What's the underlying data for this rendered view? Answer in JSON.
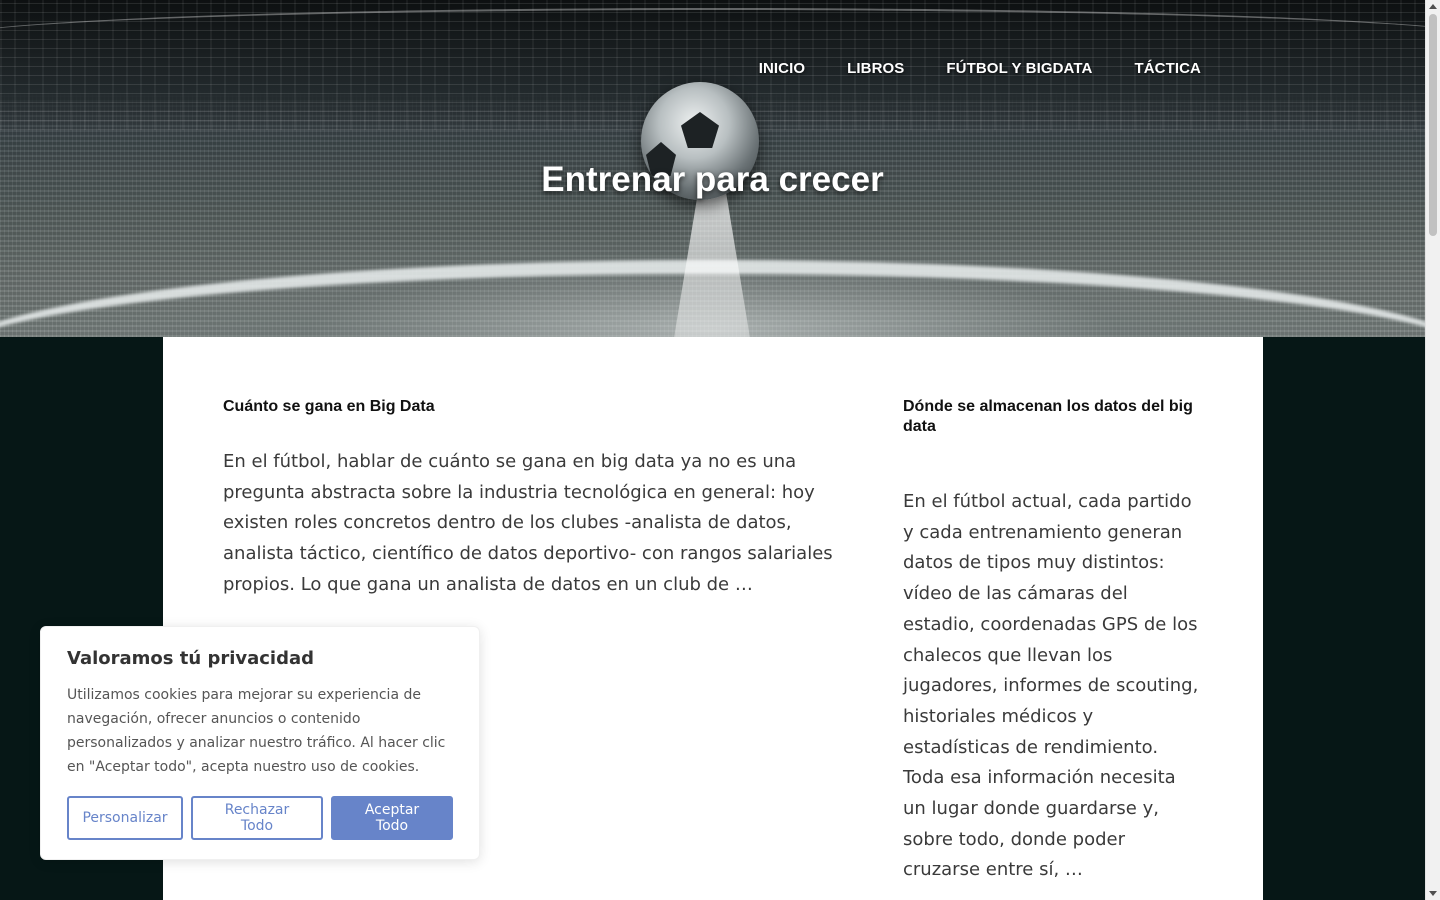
{
  "nav": {
    "items": [
      {
        "label": "INICIO"
      },
      {
        "label": "LIBROS"
      },
      {
        "label": "FÚTBOL Y BIGDATA"
      },
      {
        "label": "TÁCTICA"
      }
    ]
  },
  "hero": {
    "title": "Entrenar para crecer"
  },
  "posts": [
    {
      "title": "Cuánto se gana en Big Data",
      "excerpt": "En el fútbol, hablar de cuánto se gana en big data ya no es una pregunta abstracta sobre la industria tecnológica en general: hoy existen roles concretos dentro de los clubes -analista de datos, analista táctico, científico de datos deportivo- con rangos salariales propios. Lo que gana un analista de datos en un club de …"
    },
    {
      "title": "Dónde se almacenan los datos del big data",
      "excerpt": "En el fútbol actual, cada partido y cada entrenamiento generan datos de tipos muy distintos: vídeo de las cámaras del estadio, coordenadas GPS de los chalecos que llevan los jugadores, informes de scouting, historiales médicos y estadísticas de rendimiento. Toda esa información necesita un lugar donde guardarse y, sobre todo, donde poder cruzarse entre sí, …"
    }
  ],
  "cookie": {
    "title": "Valoramos tú privacidad",
    "text": "Utilizamos cookies para mejorar su experiencia de navegación, ofrecer anuncios o contenido personalizados y analizar nuestro tráfico. Al hacer clic en \"Aceptar todo\", acepta nuestro uso de cookies.",
    "buttons": {
      "customize": "Personalizar",
      "reject": "Rechazar Todo",
      "accept": "Aceptar Todo"
    }
  },
  "colors": {
    "background": "#061716",
    "accent": "#6784c9",
    "read_more_bar": "#e5b93a"
  }
}
